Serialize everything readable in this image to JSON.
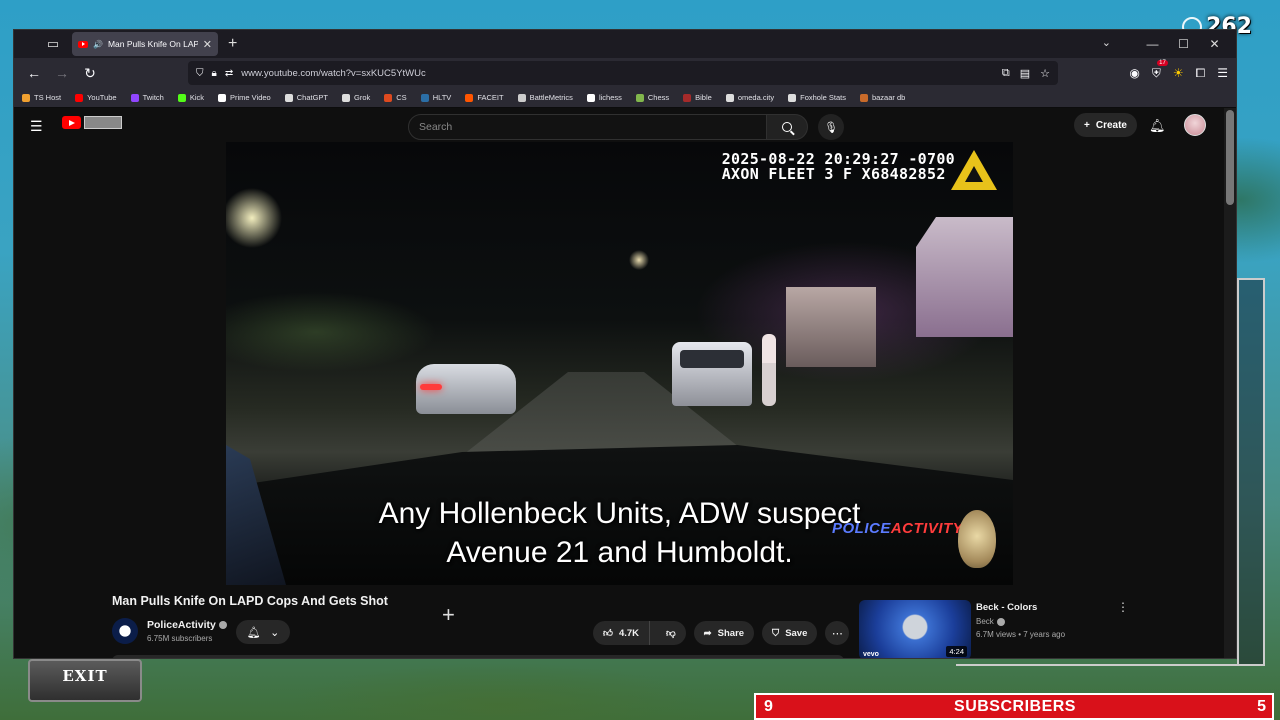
{
  "overlay": {
    "top_counter": "262",
    "exit_label": "EXIT",
    "subs_left": "9",
    "subs_label": "SUBSCRIBERS",
    "subs_right": "5"
  },
  "browser": {
    "tab_title": "Man Pulls Knife On LAPD C",
    "url": "www.youtube.com/watch?v=sxKUC5YtWUc",
    "notif_count": "17",
    "bookmarks": [
      {
        "label": "TS Host",
        "color": "#f0a030"
      },
      {
        "label": "YouTube",
        "color": "#ff0000"
      },
      {
        "label": "Twitch",
        "color": "#9146ff"
      },
      {
        "label": "Kick",
        "color": "#53fc18"
      },
      {
        "label": "Prime Video",
        "color": "#ffffff"
      },
      {
        "label": "ChatGPT",
        "color": "#dddddd"
      },
      {
        "label": "Grok",
        "color": "#dddddd"
      },
      {
        "label": "CS",
        "color": "#de4a1f"
      },
      {
        "label": "HLTV",
        "color": "#2b6ea6"
      },
      {
        "label": "FACEIT",
        "color": "#ff5500"
      },
      {
        "label": "BattleMetrics",
        "color": "#cccccc"
      },
      {
        "label": "lichess",
        "color": "#ffffff"
      },
      {
        "label": "Chess",
        "color": "#81b64c"
      },
      {
        "label": "Bible",
        "color": "#a52a2a"
      },
      {
        "label": "omeda.city",
        "color": "#dddddd"
      },
      {
        "label": "Foxhole Stats",
        "color": "#dddddd"
      },
      {
        "label": "bazaar db",
        "color": "#c86a2a"
      }
    ]
  },
  "youtube": {
    "search_placeholder": "Search",
    "create_label": "Create",
    "video": {
      "timestamp_line1": "2025-08-22 20:29:27 -0700",
      "timestamp_line2": "AXON FLEET 3 F X68482852",
      "subtitle_line1": "Any Hollenbeck Units, ADW suspect",
      "subtitle_line2": "Avenue 21 and Humboldt.",
      "watermark_police": "POLICE",
      "watermark_activity": "ACTIVITY"
    },
    "title": "Man Pulls Knife On LAPD Cops And Gets Shot",
    "channel": {
      "name": "PoliceActivity",
      "subscribers": "6.75M subscribers"
    },
    "actions": {
      "likes": "4.7K",
      "share": "Share",
      "save": "Save"
    },
    "recommendation": {
      "title": "Beck - Colors",
      "channel": "Beck",
      "meta": "6.7M views • 7 years ago",
      "duration": "4:24",
      "badge": "vevo"
    }
  }
}
